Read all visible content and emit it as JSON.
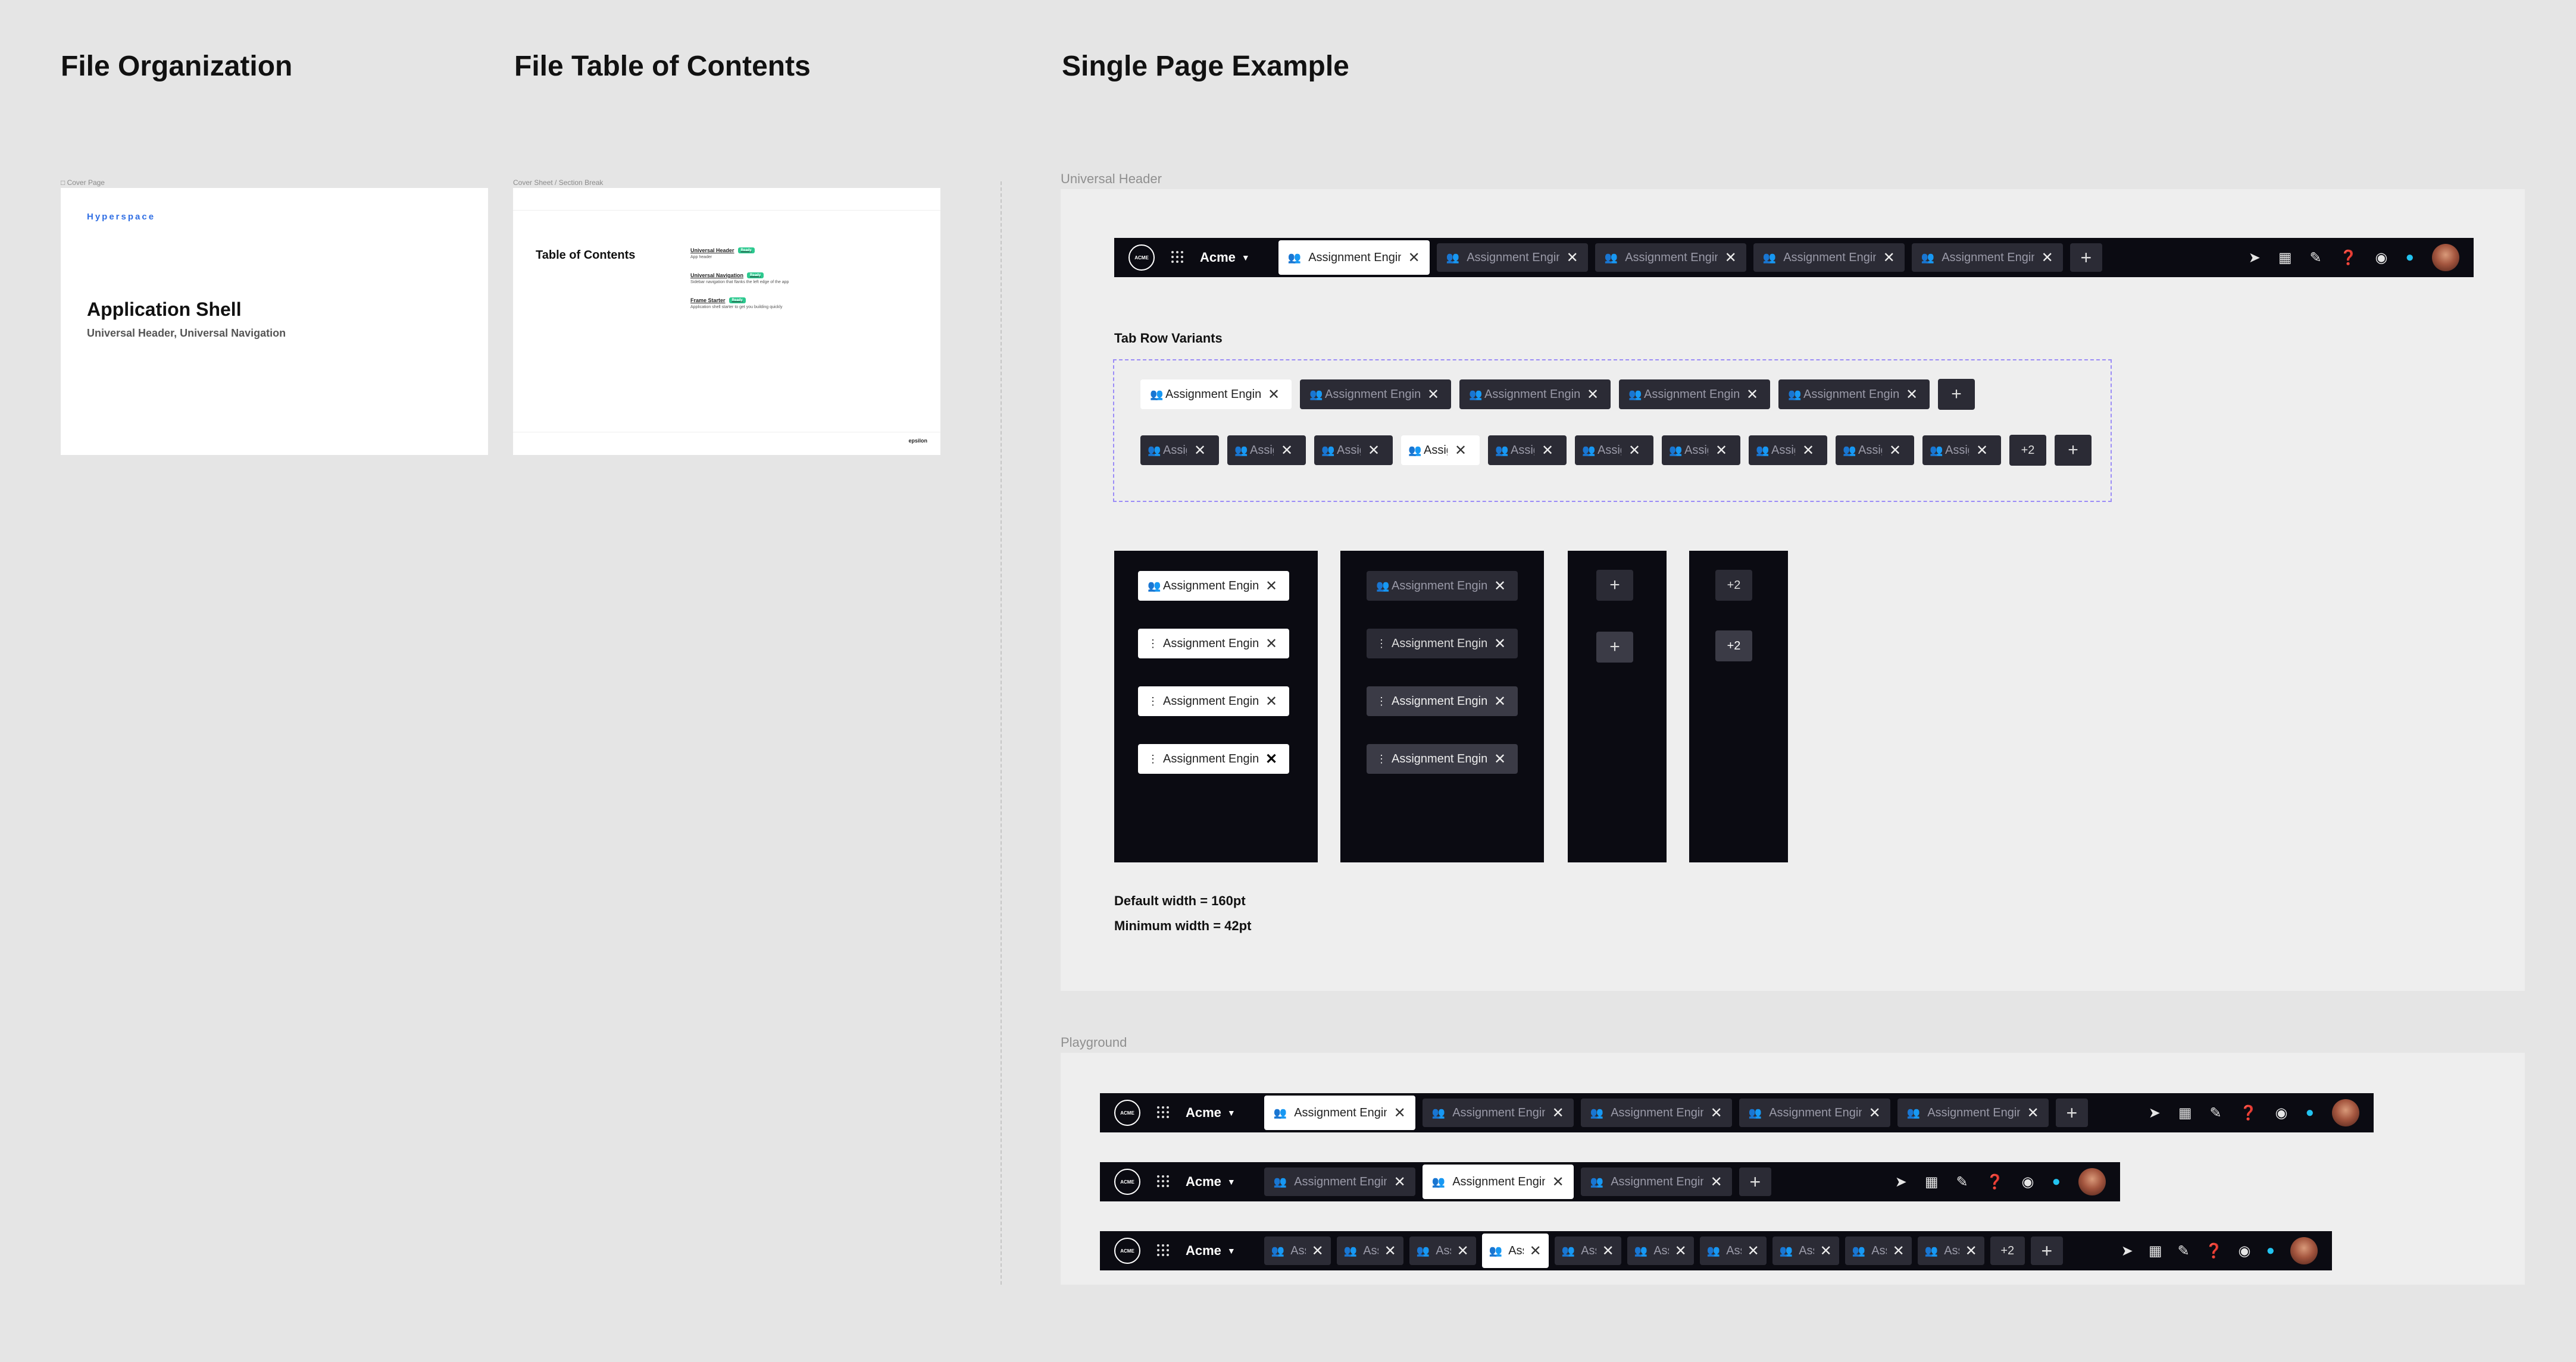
{
  "sections": {
    "file_organization": "File Organization",
    "file_toc": "File Table of Contents",
    "single_page": "Single Page Example"
  },
  "frames": {
    "cover_label": "Cover Page",
    "toc_label": "Cover Sheet / Section Break",
    "universal_header_label": "Universal Header",
    "playground_label": "Playground"
  },
  "cover": {
    "brand": "Hyperspace",
    "title": "Application Shell",
    "subtitle": "Universal Header, Universal Navigation"
  },
  "toc": {
    "title": "Table of Contents",
    "items": [
      {
        "name": "Universal Header",
        "status": "Ready",
        "desc": "App header"
      },
      {
        "name": "Universal Navigation",
        "status": "Ready",
        "desc": "Sidebar navigation that flanks the left edge of the app"
      },
      {
        "name": "Frame Starter",
        "status": "Ready",
        "desc": "Application shell starter to get you building quickly"
      }
    ],
    "logo": "epsilon"
  },
  "header": {
    "logo": "ACME",
    "org": "Acme",
    "tab_label": "Assignment Engine",
    "more": "+2"
  },
  "variants": {
    "title": "Tab Row Variants",
    "tab_label": "Assignment Engine",
    "more": "+2"
  },
  "notes": {
    "default_width": "Default width = 160pt",
    "min_width": "Minimum width = 42pt"
  },
  "icons": [
    "people-icon",
    "close-icon",
    "plus-icon",
    "bolt-icon",
    "calendar-icon",
    "pencil-icon",
    "help-icon",
    "bell-icon",
    "chat-icon",
    "apps-grid-icon",
    "kebab-icon",
    "chevron-down-icon"
  ],
  "colors": {
    "header_bg": "#0b0b12",
    "tab_inactive": "#2b2b35",
    "tab_active": "#ffffff",
    "brand_blue": "#2f6ee4",
    "status_green": "#2cc98f",
    "chat_cyan": "#22c3f0",
    "variant_border": "#9b8cf7"
  }
}
